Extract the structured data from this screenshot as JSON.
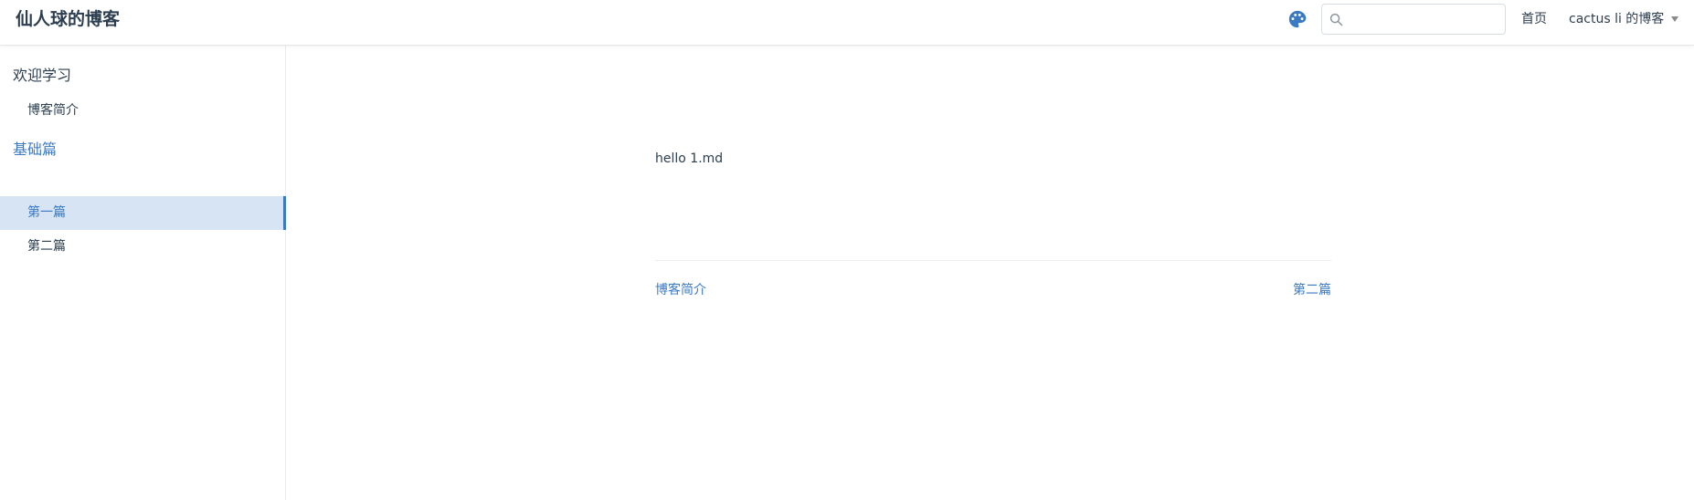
{
  "navbar": {
    "site_name": "仙人球的博客",
    "palette_icon": "palette-icon",
    "search": {
      "value": "",
      "placeholder": "",
      "icon": "search-icon"
    },
    "home_label": "首页",
    "blog_dropdown_label": "cactus li 的博客"
  },
  "sidebar": {
    "groups": [
      {
        "title": "欢迎学习",
        "active": false,
        "items": [
          {
            "label": "博客简介",
            "active": false
          }
        ]
      },
      {
        "title": "基础篇",
        "active": true,
        "items": [
          {
            "label": "第一篇",
            "active": true
          },
          {
            "label": "第二篇",
            "active": false
          }
        ]
      }
    ]
  },
  "main": {
    "text": "hello 1.md",
    "prev_label": "博客简介",
    "next_label": "第二篇"
  },
  "colors": {
    "accent": "#3a79c4",
    "active_background": "#d6e4f3",
    "text": "#2c3e50"
  }
}
